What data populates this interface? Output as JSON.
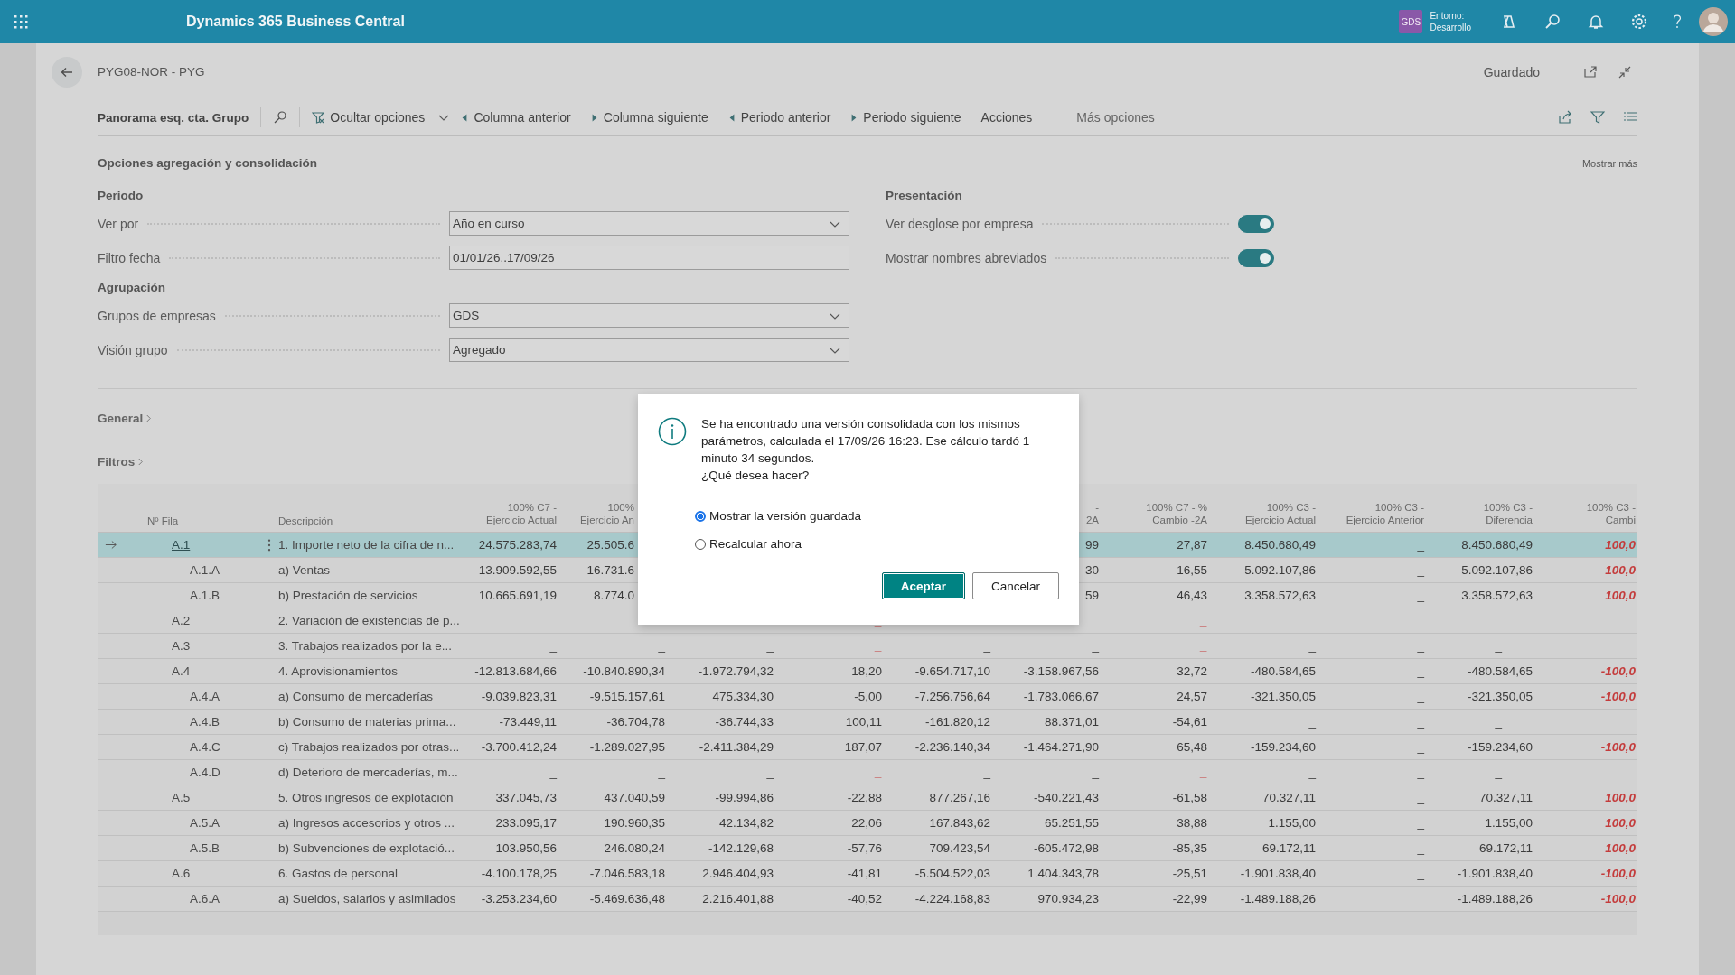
{
  "top_bar": {
    "app_title": "Dynamics 365 Business Central",
    "company_badge": "GDS",
    "environment_label": "Entorno:",
    "environment_value": "Desarrollo"
  },
  "page": {
    "title": "PYG08-NOR - PYG",
    "save_status": "Guardado"
  },
  "toolbar": {
    "view_name": "Panorama esq. cta. Grupo",
    "actions": [
      {
        "label": "Ocultar opciones",
        "kind": "filter"
      },
      {
        "label": "Columna anterior",
        "kind": "prev"
      },
      {
        "label": "Columna siguiente",
        "kind": "next"
      },
      {
        "label": "Periodo anterior",
        "kind": "prev"
      },
      {
        "label": "Periodo siguiente",
        "kind": "next"
      },
      {
        "label": "Acciones",
        "kind": "plain"
      }
    ],
    "more": "Más opciones"
  },
  "options": {
    "title": "Opciones agregación y consolidación",
    "show_more": "Mostrar más",
    "left_groups": [
      {
        "heading": "Periodo",
        "fields": [
          {
            "label": "Ver por",
            "value": "Año en curso",
            "kind": "dropdown"
          },
          {
            "label": "Filtro fecha",
            "value": "01/01/26..17/09/26",
            "kind": "text"
          }
        ]
      },
      {
        "heading": "Agrupación",
        "fields": [
          {
            "label": "Grupos de empresas",
            "value": "GDS",
            "kind": "dropdown"
          },
          {
            "label": "Visión grupo",
            "value": "Agregado",
            "kind": "dropdown"
          }
        ]
      }
    ],
    "right_group": {
      "heading": "Presentación",
      "toggles": [
        {
          "label": "Ver desglose por empresa",
          "on": true
        },
        {
          "label": "Mostrar nombres abreviados",
          "on": true
        }
      ]
    }
  },
  "fasttabs": [
    "General",
    "Filtros"
  ],
  "table": {
    "row_header": "Nº Fila",
    "description_header": "Descripción",
    "columns": [
      "100% C7 -\nEjercicio Actual",
      "100%\nEjercicio An",
      null,
      null,
      null,
      "-\n2A",
      "100% C7 - %\nCambio -2A",
      "100% C3 -\nEjercicio Actual",
      "100% C3 -\nEjercicio Anterior",
      "100% C3 -\nDiferencia",
      "100% C3 -\nCambi"
    ],
    "rows": [
      {
        "code": "A.1",
        "description": "1. Importe neto de la cifra de n...",
        "selected": true,
        "cells": [
          "24.575.283,74",
          "25.505.6",
          null,
          null,
          null,
          "99",
          "27,87",
          "8.450.680,49",
          "_",
          "8.450.680,49",
          {
            "text": "100,0",
            "alert": true
          }
        ],
        "children": [
          {
            "code": "A.1.A",
            "description": "a) Ventas",
            "selected": false,
            "cells": [
              "13.909.592,55",
              "16.731.6",
              null,
              null,
              null,
              "30",
              "16,55",
              "5.092.107,86",
              "_",
              "5.092.107,86",
              {
                "text": "100,0",
                "alert": true
              }
            ]
          },
          {
            "code": "A.1.B",
            "description": "b) Prestación de servicios",
            "selected": false,
            "cells": [
              "10.665.691,19",
              "8.774.0",
              null,
              null,
              null,
              "59",
              "46,43",
              "3.358.572,63",
              "_",
              "3.358.572,63",
              {
                "text": "100,0",
                "alert": true
              }
            ]
          }
        ]
      },
      {
        "code": "A.2",
        "description": "2. Variación de existencias de p...",
        "selected": false,
        "cells": [
          "_",
          "_",
          "_",
          {
            "text": "_",
            "alert": true
          },
          "_",
          "_",
          {
            "text": "_",
            "alert": true
          },
          "_",
          "_",
          "_",
          null
        ]
      },
      {
        "code": "A.3",
        "description": "3. Trabajos realizados por la e...",
        "selected": false,
        "cells": [
          "_",
          "_",
          "_",
          {
            "text": "_",
            "alert": true
          },
          "_",
          "_",
          {
            "text": "_",
            "alert": true
          },
          "_",
          "_",
          "_",
          null
        ]
      },
      {
        "code": "A.4",
        "description": "4. Aprovisionamientos",
        "selected": false,
        "cells": [
          "-12.813.684,66",
          "-10.840.890,34",
          "-1.972.794,32",
          "18,20",
          "-9.654.717,10",
          "-3.158.967,56",
          "32,72",
          "-480.584,65",
          "_",
          "-480.584,65",
          {
            "text": "-100,0",
            "alert": true
          }
        ],
        "children": [
          {
            "code": "A.4.A",
            "description": "a) Consumo de mercaderías",
            "selected": false,
            "cells": [
              "-9.039.823,31",
              "-9.515.157,61",
              "475.334,30",
              "-5,00",
              "-7.256.756,64",
              "-1.783.066,67",
              "24,57",
              "-321.350,05",
              "_",
              "-321.350,05",
              {
                "text": "-100,0",
                "alert": true
              }
            ]
          },
          {
            "code": "A.4.B",
            "description": "b) Consumo de materias prima...",
            "selected": false,
            "cells": [
              "-73.449,11",
              "-36.704,78",
              "-36.744,33",
              "100,11",
              "-161.820,12",
              "88.371,01",
              "-54,61",
              "_",
              "_",
              "_",
              null
            ]
          },
          {
            "code": "A.4.C",
            "description": "c) Trabajos realizados por otras...",
            "selected": false,
            "cells": [
              "-3.700.412,24",
              "-1.289.027,95",
              "-2.411.384,29",
              "187,07",
              "-2.236.140,34",
              "-1.464.271,90",
              "65,48",
              "-159.234,60",
              "_",
              "-159.234,60",
              {
                "text": "-100,0",
                "alert": true
              }
            ]
          },
          {
            "code": "A.4.D",
            "description": "d) Deterioro de mercaderías, m...",
            "selected": false,
            "cells": [
              "_",
              "_",
              "_",
              {
                "text": "_",
                "alert": true
              },
              "_",
              "_",
              {
                "text": "_",
                "alert": true
              },
              "_",
              "_",
              "_",
              null
            ]
          }
        ]
      },
      {
        "code": "A.5",
        "description": "5. Otros ingresos de explotación",
        "selected": false,
        "cells": [
          "337.045,73",
          "437.040,59",
          "-99.994,86",
          "-22,88",
          "877.267,16",
          "-540.221,43",
          "-61,58",
          "70.327,11",
          "_",
          "70.327,11",
          {
            "text": "100,0",
            "alert": true
          }
        ],
        "children": [
          {
            "code": "A.5.A",
            "description": "a) Ingresos accesorios y otros ...",
            "selected": false,
            "cells": [
              "233.095,17",
              "190.960,35",
              "42.134,82",
              "22,06",
              "167.843,62",
              "65.251,55",
              "38,88",
              "1.155,00",
              "_",
              "1.155,00",
              {
                "text": "100,0",
                "alert": true
              }
            ]
          },
          {
            "code": "A.5.B",
            "description": "b) Subvenciones de explotació...",
            "selected": false,
            "cells": [
              "103.950,56",
              "246.080,24",
              "-142.129,68",
              "-57,76",
              "709.423,54",
              "-605.472,98",
              "-85,35",
              "69.172,11",
              "_",
              "69.172,11",
              {
                "text": "100,0",
                "alert": true
              }
            ]
          }
        ]
      },
      {
        "code": "A.6",
        "description": "6. Gastos de personal",
        "selected": false,
        "cells": [
          "-4.100.178,25",
          "-7.046.583,18",
          "2.946.404,93",
          "-41,81",
          "-5.504.522,03",
          "1.404.343,78",
          "-25,51",
          "-1.901.838,40",
          "_",
          "-1.901.838,40",
          {
            "text": "-100,0",
            "alert": true
          }
        ],
        "children": [
          {
            "code": "A.6.A",
            "description": "a) Sueldos, salarios y asimilados",
            "selected": false,
            "cells": [
              "-3.253.234,60",
              "-5.469.636,48",
              "2.216.401,88",
              "-40,52",
              "-4.224.168,83",
              "970.934,23",
              "-22,99",
              "-1.489.188,26",
              "_",
              "-1.489.188,26",
              {
                "text": "-100,0",
                "alert": true
              }
            ]
          }
        ]
      }
    ]
  },
  "dialog": {
    "message": "Se ha encontrado una versión consolidada con los mismos parámetros, calculada el 17/09/26 16:23. Ese cálculo tardó 1 minuto 34 segundos.",
    "question": "¿Qué desea hacer?",
    "choices": [
      {
        "label": "Mostrar la versión guardada",
        "selected": true
      },
      {
        "label": "Recalcular ahora",
        "selected": false
      }
    ],
    "buttons": [
      {
        "label": "Aceptar",
        "kind": "primary"
      },
      {
        "label": "Cancelar",
        "kind": "secondary"
      }
    ]
  }
}
